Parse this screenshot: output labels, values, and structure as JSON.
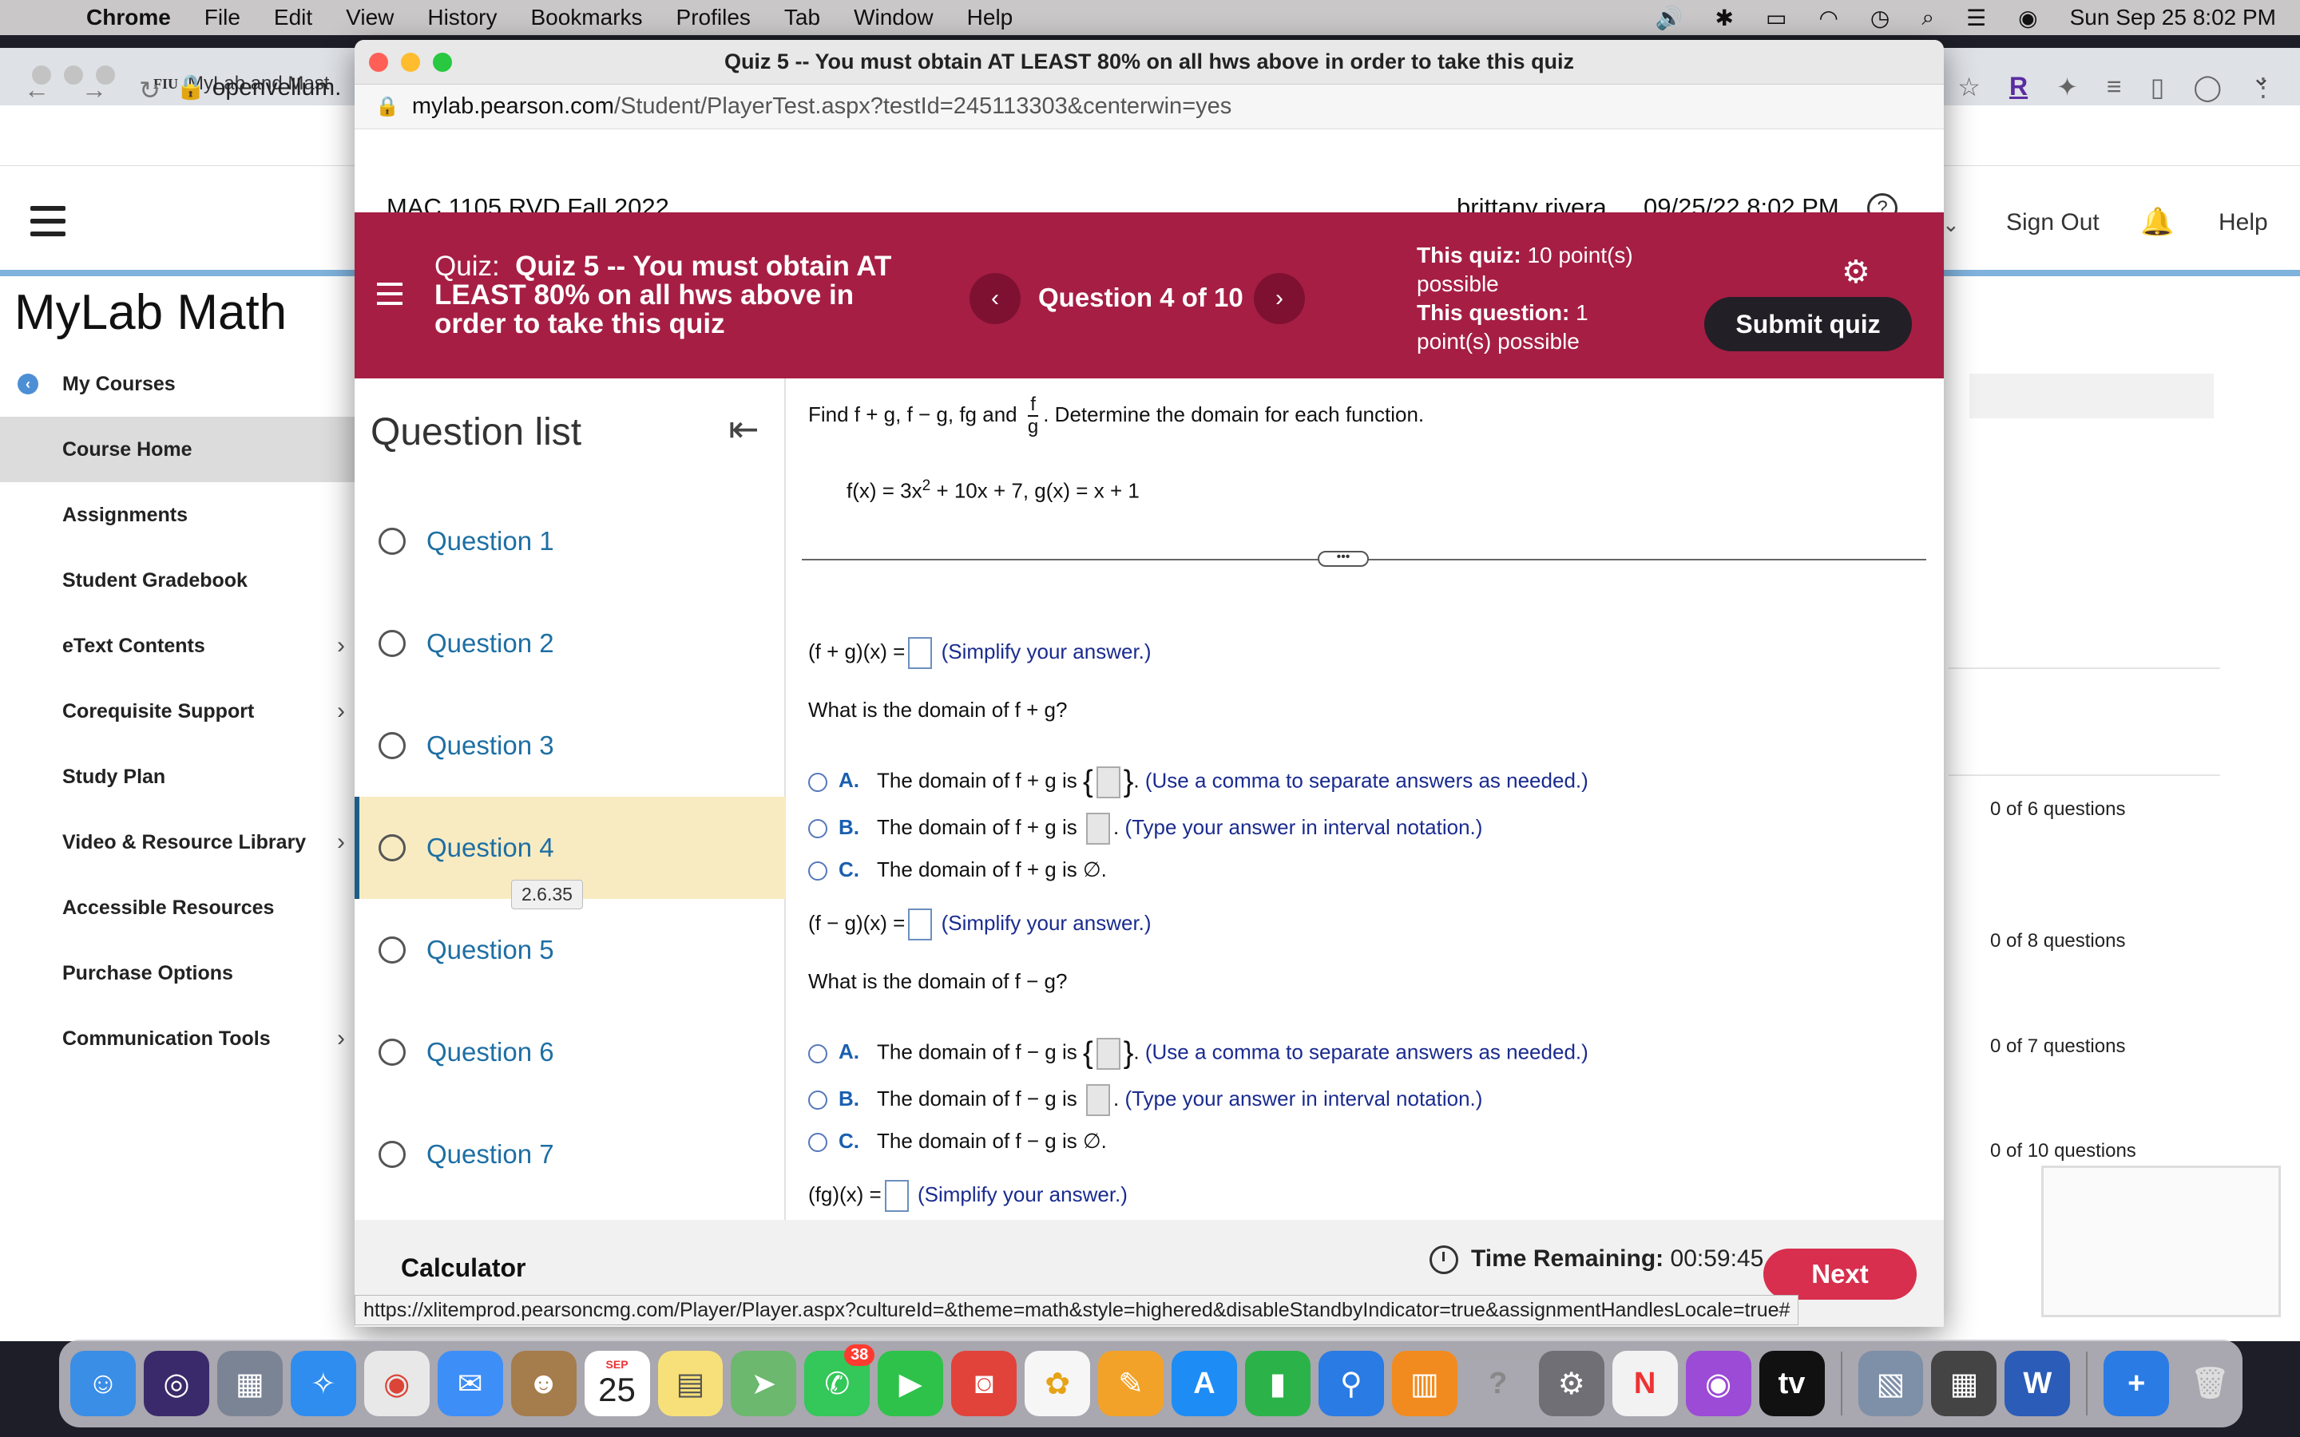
{
  "menubar": {
    "app": "Chrome",
    "items": [
      "File",
      "Edit",
      "View",
      "History",
      "Bookmarks",
      "Profiles",
      "Tab",
      "Window",
      "Help"
    ],
    "datetime": "Sun Sep 25  8:02 PM"
  },
  "bg_browser": {
    "tab_prefix": "FIU",
    "tab_title": "MyLab and Mast",
    "url": "openvellum.",
    "ext_r": "R",
    "sign_out": "Sign Out",
    "help": "Help",
    "brand": "MyLab Math",
    "nav": [
      {
        "label": "My Courses"
      },
      {
        "label": "Course Home"
      },
      {
        "label": "Assignments"
      },
      {
        "label": "Student Gradebook"
      },
      {
        "label": "eText Contents"
      },
      {
        "label": "Corequisite Support"
      },
      {
        "label": "Study Plan"
      },
      {
        "label": "Video & Resource Library"
      },
      {
        "label": "Accessible Resources"
      },
      {
        "label": "Purchase Options"
      },
      {
        "label": "Communication Tools"
      }
    ],
    "counts": [
      "0 of 6 questions",
      "0 of 8 questions",
      "0 of 7 questions",
      "0 of 10 questions"
    ]
  },
  "popup": {
    "window_title": "Quiz 5 -- You must obtain AT LEAST 80% on all hws above in order to take this quiz",
    "url_host": "mylab.pearson.com",
    "url_path": "/Student/PlayerTest.aspx?testId=245113303&centerwin=yes",
    "course": "MAC 1105 RVD Fall 2022",
    "user": "brittany rivera",
    "timestamp": "09/25/22 8:02 PM",
    "help_icon": "?",
    "quiz_label": "Quiz:",
    "quiz_title": "Quiz 5 -- You must obtain AT LEAST 80% on all hws above in order to take this quiz",
    "question_nav": "Question 4 of 10",
    "this_quiz_label": "This quiz:",
    "this_quiz_value": "10 point(s) possible",
    "this_question_label": "This question:",
    "this_question_value": "1 point(s) possible",
    "submit": "Submit quiz",
    "question_list_title": "Question list",
    "questions": [
      "Question 1",
      "Question 2",
      "Question 3",
      "Question 4",
      "Question 5",
      "Question 6",
      "Question 7"
    ],
    "active_question_tip": "2.6.35",
    "calculator": "Calculator",
    "time_label": "Time Remaining:",
    "time_value": "00:59:45",
    "next": "Next",
    "status_url": "https://xlitemprod.pearsoncmg.com/Player/Player.aspx?cultureId=&theme=math&style=highered&disableStandbyIndicator=true&assignmentHandlesLocale=true#"
  },
  "problem": {
    "prompt_pre": "Find f + g, f − g, fg and",
    "frac_num": "f",
    "frac_den": "g",
    "prompt_post": ". Determine the domain for each function.",
    "func_a": "f(x) = 3x",
    "exp": "2",
    "func_b": " + 10x + 7, g(x) = x + 1",
    "handle": "•••",
    "sum_label": "(f + g)(x) =",
    "simplify": "(Simplify your answer.)",
    "sum_domain_q": "What is the domain of f + g?",
    "sum_a_pre": "The domain of f + g is",
    "sum_b_pre": "The domain of f + g is",
    "sum_c": "The domain of f + g is ∅.",
    "diff_label": "(f − g)(x) =",
    "diff_domain_q": "What is the domain of f − g?",
    "diff_a_pre": "The domain of f − g is",
    "diff_b_pre": "The domain of f − g is",
    "diff_c": "The domain of f − g is ∅.",
    "prod_label": "(fg)(x) =",
    "hint_comma": "(Use a comma to separate answers as needed.)",
    "hint_interval": "(Type your answer in interval notation.)",
    "letters": [
      "A.",
      "B.",
      "C."
    ]
  },
  "dock": {
    "calendar_month": "SEP",
    "calendar_day": "25",
    "messages_badge": "38",
    "tv_label": "tv"
  }
}
